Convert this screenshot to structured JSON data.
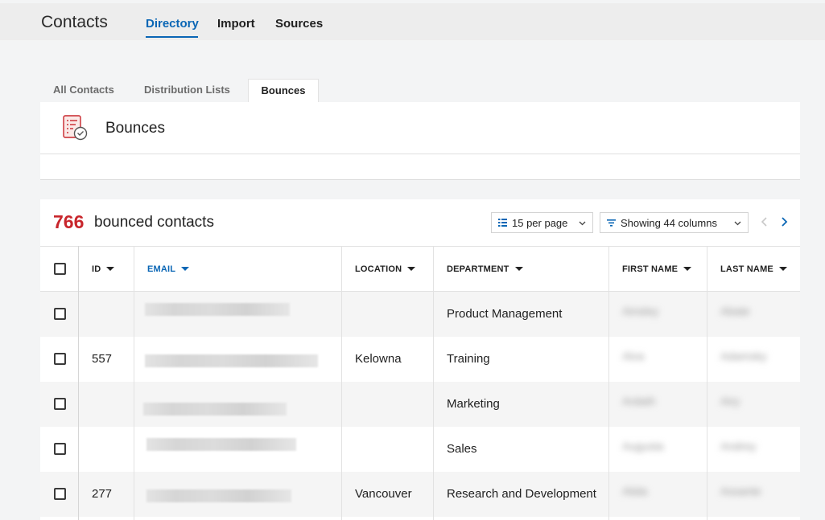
{
  "header": {
    "app_title": "Contacts",
    "tabs": [
      {
        "label": "Directory",
        "active": true
      },
      {
        "label": "Import",
        "active": false
      },
      {
        "label": "Sources",
        "active": false
      }
    ]
  },
  "subtabs": [
    {
      "label": "All Contacts",
      "active": false
    },
    {
      "label": "Distribution Lists",
      "active": false
    },
    {
      "label": "Bounces",
      "active": true
    }
  ],
  "bounces_card": {
    "title": "Bounces",
    "icon": "bounced-list-icon"
  },
  "results": {
    "count": "766",
    "count_label": "bounced contacts",
    "per_page": {
      "label": "15 per page",
      "icon": "list-icon"
    },
    "columns_filter": {
      "label": "Showing 44 columns",
      "icon": "filter-icon"
    },
    "pager": {
      "prev_icon": "chevron-left-icon",
      "next_icon": "chevron-right-icon"
    }
  },
  "table": {
    "columns": [
      {
        "key": "id",
        "label": "ID",
        "sorted": false
      },
      {
        "key": "email",
        "label": "EMAIL",
        "sorted": true
      },
      {
        "key": "location",
        "label": "LOCATION",
        "sorted": false
      },
      {
        "key": "department",
        "label": "DEPARTMENT",
        "sorted": false
      },
      {
        "key": "first_name",
        "label": "FIRST NAME",
        "sorted": false
      },
      {
        "key": "last_name",
        "label": "LAST NAME",
        "sorted": false
      }
    ],
    "rows": [
      {
        "id": "",
        "location": "",
        "department": "Product Management",
        "first_name": "Ainsley",
        "last_name": "Abate"
      },
      {
        "id": "557",
        "location": "Kelowna",
        "department": "Training",
        "first_name": "Alva",
        "last_name": "Adamsky"
      },
      {
        "id": "",
        "location": "",
        "department": "Marketing",
        "first_name": "Ardath",
        "last_name": "Airy"
      },
      {
        "id": "",
        "location": "",
        "department": "Sales",
        "first_name": "Augusta",
        "last_name": "Andrey"
      },
      {
        "id": "277",
        "location": "Vancouver",
        "department": "Research and Development",
        "first_name": "Alida",
        "last_name": "Assante"
      }
    ]
  },
  "colors": {
    "accent": "#0a66b5",
    "count_red": "#c8262c",
    "row_shade": "#f5f5f5"
  }
}
